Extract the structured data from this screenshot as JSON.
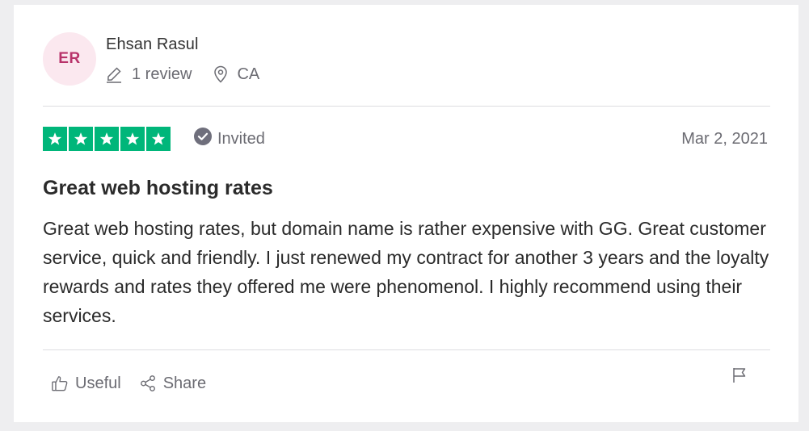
{
  "reviewer": {
    "initials": "ER",
    "name": "Ehsan Rasul",
    "review_count": "1 review",
    "location": "CA"
  },
  "rating": {
    "stars": 5,
    "max": 5,
    "color": "#00b67a"
  },
  "verification": {
    "label": "Invited"
  },
  "review": {
    "date": "Mar 2, 2021",
    "title": "Great web hosting rates",
    "body": "Great web hosting rates, but domain name is rather expensive with GG. Great customer service, quick and friendly. I just renewed my contract for another 3 years and the loyalty rewards and rates they offered me were phenomenol. I highly recommend using their services."
  },
  "actions": {
    "useful_label": "Useful",
    "share_label": "Share"
  },
  "icons": {
    "review_count": "pencil-icon",
    "location": "location-pin-icon",
    "verification": "check-circle-icon",
    "useful": "thumbs-up-icon",
    "share": "share-icon",
    "report": "flag-icon"
  }
}
